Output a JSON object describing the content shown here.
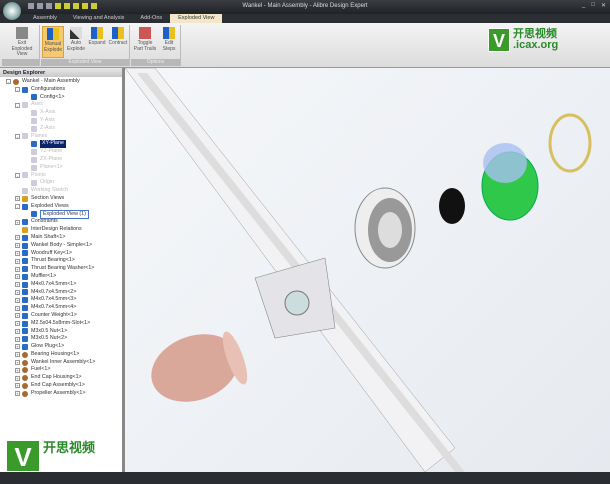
{
  "window": {
    "title": "Wankel - Main Assembly - Alibre Design Expert",
    "controls": [
      "_",
      "□",
      "✕"
    ]
  },
  "tabs": [
    "Assembly",
    "Viewing and Analysis",
    "Add-Ons",
    "Exploded View"
  ],
  "ribbon": {
    "exit": {
      "label": "Exit Exploded View"
    },
    "exploded_group": {
      "label": "Exploded View",
      "buttons": [
        "Manual Explode",
        "Auto Explode",
        "Expand",
        "Contract"
      ]
    },
    "options_group": {
      "label": "Options",
      "buttons": [
        "Toggle Part Trails",
        "Edit Steps"
      ]
    }
  },
  "explorer": {
    "title": "Design Explorer",
    "items": [
      {
        "label": "Wankel - Main Assembly",
        "level": 0,
        "exp": "-",
        "icon": "brown"
      },
      {
        "label": "Configurations",
        "level": 1,
        "exp": "-",
        "icon": "blue"
      },
      {
        "label": "Config<1>",
        "level": 2,
        "icon": "blue"
      },
      {
        "label": "Axes",
        "level": 1,
        "exp": "-",
        "faded": true
      },
      {
        "label": "X-Axis",
        "level": 2,
        "faded": true
      },
      {
        "label": "Y-Axis",
        "level": 2,
        "faded": true
      },
      {
        "label": "Z-Axis",
        "level": 2,
        "faded": true
      },
      {
        "label": "Planes",
        "level": 1,
        "exp": "-",
        "faded": true
      },
      {
        "label": "XY-Plane",
        "level": 2,
        "sel": true
      },
      {
        "label": "YZ-Plane",
        "level": 2,
        "faded": true
      },
      {
        "label": "ZX-Plane",
        "level": 2,
        "faded": true
      },
      {
        "label": "Plane<1>",
        "level": 2,
        "faded": true
      },
      {
        "label": "Points",
        "level": 1,
        "exp": "-",
        "faded": true
      },
      {
        "label": "Origin",
        "level": 2,
        "faded": true
      },
      {
        "label": "Working Sketch",
        "level": 1,
        "faded": true
      },
      {
        "label": "Section Views",
        "level": 1,
        "exp": "+",
        "icon": "yellow"
      },
      {
        "label": "Exploded Views",
        "level": 1,
        "exp": "-",
        "icon": "blue"
      },
      {
        "label": "Exploded View (1)",
        "level": 2,
        "box": true
      },
      {
        "label": "Constraints",
        "level": 1,
        "exp": "+"
      },
      {
        "label": "InterDesign Relations",
        "level": 1,
        "icon": "yellow"
      },
      {
        "label": "Main Shaft<1>",
        "level": 1,
        "exp": "+"
      },
      {
        "label": "Wankel Body - Simple<1>",
        "level": 1,
        "exp": "+"
      },
      {
        "label": "Woodruff Key<1>",
        "level": 1,
        "exp": "+"
      },
      {
        "label": "Thrust Bearing<1>",
        "level": 1,
        "exp": "+"
      },
      {
        "label": "Thrust Bearing Washer<1>",
        "level": 1,
        "exp": "+"
      },
      {
        "label": "Muffler<1>",
        "level": 1,
        "exp": "+"
      },
      {
        "label": "M4x0.7x4.5mm<1>",
        "level": 1,
        "exp": "+"
      },
      {
        "label": "M4x0.7x4.5mm<2>",
        "level": 1,
        "exp": "+"
      },
      {
        "label": "M4x0.7x4.5mm<3>",
        "level": 1,
        "exp": "+"
      },
      {
        "label": "M4x0.7x4.5mm<4>",
        "level": 1,
        "exp": "+"
      },
      {
        "label": "Counter Weight<1>",
        "level": 1,
        "exp": "+"
      },
      {
        "label": "M2.5x04.5x8mm-Slot<1>",
        "level": 1,
        "exp": "+"
      },
      {
        "label": "M3x0.5 Nut<1>",
        "level": 1,
        "exp": "+"
      },
      {
        "label": "M3x0.5 Nut<2>",
        "level": 1,
        "exp": "+"
      },
      {
        "label": "Glow Plug<1>",
        "level": 1,
        "exp": "+"
      },
      {
        "label": "Bearing Housing<1>",
        "level": 1,
        "exp": "+",
        "icon": "brown"
      },
      {
        "label": "Wankel Inner Assembly<1>",
        "level": 1,
        "exp": "+",
        "icon": "brown"
      },
      {
        "label": "Fuel<1>",
        "level": 1,
        "exp": "+",
        "icon": "brown"
      },
      {
        "label": "End Cap Housing<1>",
        "level": 1,
        "exp": "+",
        "icon": "brown"
      },
      {
        "label": "End Cap Assembly<1>",
        "level": 1,
        "exp": "+",
        "icon": "brown"
      },
      {
        "label": "Propeller Assembly<1>",
        "level": 1,
        "exp": "+",
        "icon": "brown"
      }
    ]
  },
  "watermark": {
    "letter": "V",
    "cn": "开思视频",
    "site": ".icax.org"
  }
}
